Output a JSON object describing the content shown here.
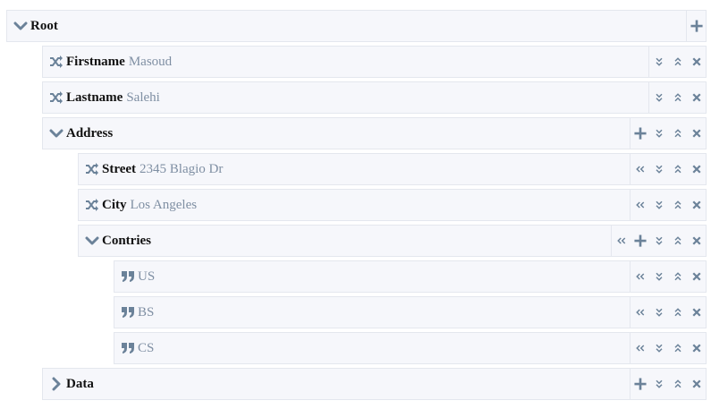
{
  "root": {
    "label": "Root"
  },
  "firstname": {
    "key": "Firstname",
    "value": "Masoud"
  },
  "lastname": {
    "key": "Lastname",
    "value": "Salehi"
  },
  "address": {
    "label": "Address"
  },
  "street": {
    "key": "Street",
    "value": "2345 Blagio Dr"
  },
  "city": {
    "key": "City",
    "value": "Los Angeles"
  },
  "contries": {
    "label": "Contries"
  },
  "contries_items": [
    "US",
    "BS",
    "CS"
  ],
  "data": {
    "label": "Data"
  },
  "colors": {
    "icon": "#6b8299",
    "row_bg": "#f6f7fb",
    "border": "#e4e7ee",
    "value_text": "#7f8fa3"
  },
  "icons": [
    "chevron-down-icon",
    "chevron-right-icon",
    "shuffle-icon",
    "quote-icon",
    "plus-icon",
    "angle-double-down-icon",
    "angle-double-up-icon",
    "angle-double-left-icon",
    "close-icon"
  ]
}
